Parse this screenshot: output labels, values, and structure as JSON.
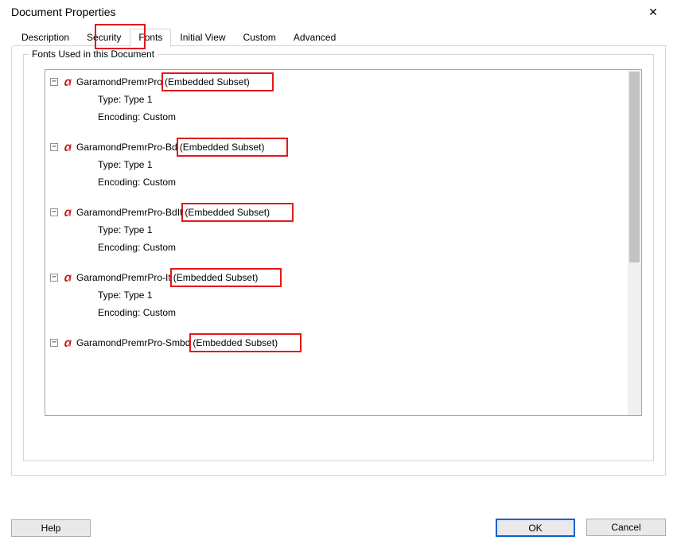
{
  "window": {
    "title": "Document Properties"
  },
  "tabs": [
    {
      "label": "Description"
    },
    {
      "label": "Security"
    },
    {
      "label": "Fonts"
    },
    {
      "label": "Initial View"
    },
    {
      "label": "Custom"
    },
    {
      "label": "Advanced"
    }
  ],
  "active_tab_index": 2,
  "group": {
    "label": "Fonts Used in this Document"
  },
  "embedded_text": "(Embedded Subset)",
  "type_label": "Type:",
  "encoding_label": "Encoding:",
  "type_value": "Type 1",
  "encoding_value": "Custom",
  "fonts": [
    {
      "name": "GaramondPremrPro",
      "highlight_embedded": true
    },
    {
      "name": "GaramondPremrPro-Bd",
      "highlight_embedded": true
    },
    {
      "name": "GaramondPremrPro-BdIt",
      "highlight_embedded": true
    },
    {
      "name": "GaramondPremrPro-It",
      "highlight_embedded": true
    },
    {
      "name": "GaramondPremrPro-Smbd",
      "highlight_embedded": true
    }
  ],
  "buttons": {
    "help": "Help",
    "ok": "OK",
    "cancel": "Cancel"
  },
  "highlight_tab_index": 2
}
